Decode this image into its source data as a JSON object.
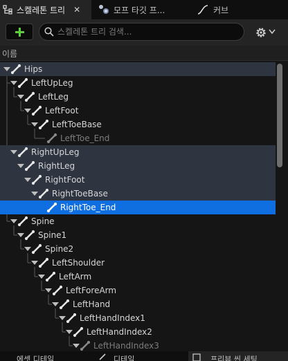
{
  "tabs": [
    {
      "label": "스켈레톤 트리",
      "icon": "skeleton-tree-icon",
      "active": true,
      "close": "✕"
    },
    {
      "label": "모프 타깃 프...",
      "icon": "morph-target-icon",
      "active": false
    },
    {
      "label": "커브",
      "icon": "curve-icon",
      "active": false
    }
  ],
  "toolbar": {
    "add_icon": "plus-icon",
    "search_placeholder": "스켈레톤 트리 검색...",
    "settings_icon": "gear-icon"
  },
  "header": {
    "name_label": "이름"
  },
  "colors": {
    "highlight_row": "#2e3440",
    "selected_row": "#0f6fe0",
    "add_green": "#5ccd3c",
    "background": "#151515"
  },
  "tree": [
    {
      "label": "Hips",
      "depth": 0,
      "expanded": true,
      "highlight": true,
      "dim": false,
      "selected": false
    },
    {
      "label": "LeftUpLeg",
      "depth": 1,
      "expanded": true,
      "highlight": false,
      "dim": false,
      "selected": false
    },
    {
      "label": "LeftLeg",
      "depth": 2,
      "expanded": true,
      "highlight": false,
      "dim": false,
      "selected": false
    },
    {
      "label": "LeftFoot",
      "depth": 3,
      "expanded": true,
      "highlight": false,
      "dim": false,
      "selected": false
    },
    {
      "label": "LeftToeBase",
      "depth": 4,
      "expanded": true,
      "highlight": false,
      "dim": false,
      "selected": false
    },
    {
      "label": "LeftToe_End",
      "depth": 5,
      "expanded": false,
      "highlight": false,
      "dim": true,
      "selected": false
    },
    {
      "label": "RightUpLeg",
      "depth": 1,
      "expanded": true,
      "highlight": true,
      "dim": false,
      "selected": false
    },
    {
      "label": "RightLeg",
      "depth": 2,
      "expanded": true,
      "highlight": true,
      "dim": false,
      "selected": false
    },
    {
      "label": "RightFoot",
      "depth": 3,
      "expanded": true,
      "highlight": true,
      "dim": false,
      "selected": false
    },
    {
      "label": "RightToeBase",
      "depth": 4,
      "expanded": true,
      "highlight": true,
      "dim": false,
      "selected": false
    },
    {
      "label": "RightToe_End",
      "depth": 5,
      "expanded": false,
      "highlight": false,
      "dim": false,
      "selected": true
    },
    {
      "label": "Spine",
      "depth": 1,
      "expanded": true,
      "highlight": false,
      "dim": false,
      "selected": false
    },
    {
      "label": "Spine1",
      "depth": 2,
      "expanded": true,
      "highlight": false,
      "dim": false,
      "selected": false
    },
    {
      "label": "Spine2",
      "depth": 3,
      "expanded": true,
      "highlight": false,
      "dim": false,
      "selected": false
    },
    {
      "label": "LeftShoulder",
      "depth": 4,
      "expanded": true,
      "highlight": false,
      "dim": false,
      "selected": false
    },
    {
      "label": "LeftArm",
      "depth": 5,
      "expanded": true,
      "highlight": false,
      "dim": false,
      "selected": false
    },
    {
      "label": "LeftForeArm",
      "depth": 6,
      "expanded": true,
      "highlight": false,
      "dim": false,
      "selected": false
    },
    {
      "label": "LeftHand",
      "depth": 7,
      "expanded": true,
      "highlight": false,
      "dim": false,
      "selected": false
    },
    {
      "label": "LeftHandIndex1",
      "depth": 8,
      "expanded": true,
      "highlight": false,
      "dim": false,
      "selected": false
    },
    {
      "label": "LeftHandIndex2",
      "depth": 9,
      "expanded": true,
      "highlight": false,
      "dim": false,
      "selected": false
    },
    {
      "label": "LeftHandIndex3",
      "depth": 10,
      "expanded": true,
      "highlight": false,
      "dim": true,
      "selected": false
    }
  ],
  "bottom_tabs": [
    {
      "label": "에셋 디테일",
      "active": false
    },
    {
      "label": "디테일",
      "active": false
    },
    {
      "label": "프리뷰 씬 세팅",
      "active": true
    }
  ]
}
